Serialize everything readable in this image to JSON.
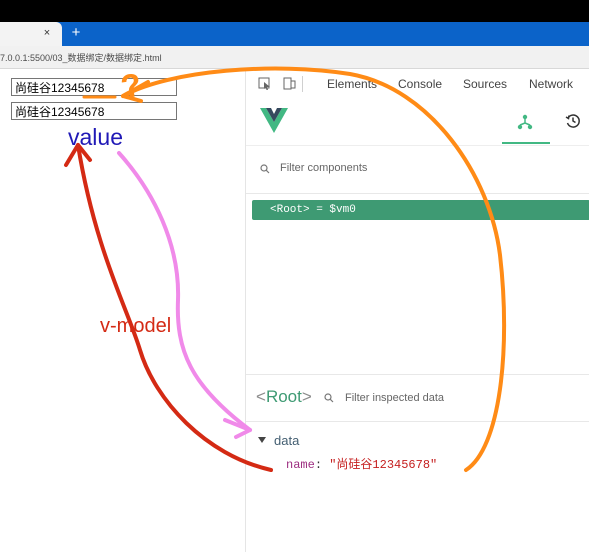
{
  "browser": {
    "tab_close": "×",
    "new_tab": "+",
    "address": "7.0.0.1:5500/03_数据绑定/数据绑定.html"
  },
  "page": {
    "inputs": [
      {
        "value": "尚硅谷12345678"
      },
      {
        "value": "尚硅谷12345678"
      }
    ]
  },
  "devtools": {
    "tabs": [
      {
        "label": "Elements"
      },
      {
        "label": "Console"
      },
      {
        "label": "Sources"
      },
      {
        "label": "Network"
      }
    ],
    "icons": {
      "inspect": "cursor-select-icon",
      "device": "device-toggle-icon",
      "components": "components-tree-icon",
      "timeline": "history-icon",
      "search": "search-icon"
    },
    "vue": {
      "filter_placeholder": "Filter components",
      "selected_component": "<Root> = $vm0"
    },
    "inspect": {
      "title_left": "<",
      "title_name": "Root",
      "title_right": ">",
      "placeholder": "Filter inspected data",
      "section": "data",
      "property": {
        "key": "name",
        "colon": ":",
        "value": "\"尚硅谷12345678\""
      }
    }
  },
  "annotations": {
    "value": "value",
    "vmodel": "v-model",
    "question": "?",
    "colors": {
      "value": "#2019b6",
      "vmodel": "#d42a14",
      "question": "#ff8b16",
      "pink_arrow": "#f08ae9",
      "vue_green": "#3e9a73",
      "chrome_blue": "#0b63c9"
    }
  }
}
